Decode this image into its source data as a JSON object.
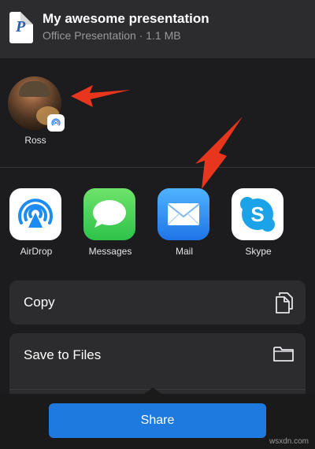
{
  "header": {
    "title": "My awesome presentation",
    "subtitle": "Office Presentation · 1.1 MB",
    "file_icon_letter": "P"
  },
  "people": [
    {
      "name": "Ross",
      "badge_icon": "airdrop-icon"
    }
  ],
  "apps": [
    {
      "label": "AirDrop",
      "icon": "airdrop-icon"
    },
    {
      "label": "Messages",
      "icon": "messages-icon"
    },
    {
      "label": "Mail",
      "icon": "mail-icon"
    },
    {
      "label": "Skype",
      "icon": "skype-icon"
    }
  ],
  "actions": [
    {
      "label": "Copy",
      "icon": "copy-icon"
    },
    {
      "label": "Save to Files",
      "icon": "folder-icon"
    }
  ],
  "share_button": {
    "label": "Share"
  },
  "watermark": "wsxdn.com",
  "colors": {
    "accent": "#1f7ae0",
    "arrow": "#e8361e",
    "sheet_bg": "#1c1c1e",
    "row_bg": "#2c2c2e"
  }
}
